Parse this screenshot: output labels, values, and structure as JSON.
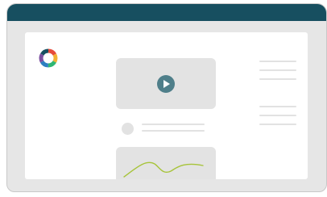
{
  "window": {
    "titlebar_color": "#174f60",
    "frame_color": "#e6e6e6",
    "content_bg": "#ffffff"
  },
  "logo": {
    "icon": "colorful-ring-logo",
    "colors": [
      "#e64b3b",
      "#f2b134",
      "#2fb673",
      "#2d7fc1",
      "#7b4fa0",
      "#174f60"
    ]
  },
  "video_card": {
    "icon": "play-icon",
    "accent": "#4f7f8a"
  },
  "chart_card": {
    "icon": "line-chart-icon",
    "line_color": "#a7c43a"
  },
  "placeholder_color": "#e2e2e2"
}
